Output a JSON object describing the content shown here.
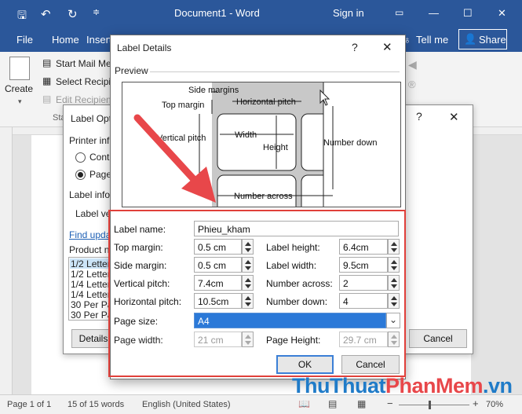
{
  "word": {
    "doc_title": "Document1  -  Word",
    "sign_in": "Sign in",
    "tabs": [
      "File",
      "Home",
      "Insert"
    ],
    "tell_me": "Tell me",
    "share": "Share",
    "ribbon": {
      "create": "Create",
      "start_mail_merge": "Start Mail Me",
      "select_recipients": "Select Recipie",
      "edit_recipients": "Edit Recipien",
      "group_prefix": "Sta"
    }
  },
  "status": {
    "page": "Page 1 of 1",
    "words": "15 of 15 words",
    "language": "English (United States)",
    "zoom": "70%"
  },
  "label_options": {
    "title": "Label Opt",
    "printer_info": "Printer inf",
    "cont": "Cont",
    "page": "Page",
    "label_info": "Label info",
    "label_vendor": "Label ve",
    "find_updates": "Find upda",
    "product_number": "Product n",
    "products": [
      "1/2 Letter",
      "1/2 Letter",
      "1/4 Letter",
      "1/4 Letter",
      "30 Per Pa",
      "30 Per Pa"
    ],
    "details_btn": "Details",
    "cancel_btn": "Cancel"
  },
  "dialog": {
    "title": "Label Details",
    "help": "?",
    "close": "✕",
    "preview_label": "Preview",
    "preview": {
      "side_margins": "Side margins",
      "top_margin": "Top margin",
      "horizontal_pitch": "Horizontal pitch",
      "width": "Width",
      "height": "Height",
      "vertical_pitch": "Vertical pitch",
      "number_down": "Number down",
      "number_across": "Number across"
    },
    "fields": {
      "label_name": {
        "label": "Label name:",
        "value": "Phieu_kham"
      },
      "top_margin": {
        "label": "Top margin:",
        "value": "0.5 cm"
      },
      "label_height": {
        "label": "Label height:",
        "value": "6.4cm"
      },
      "side_margin": {
        "label": "Side margin:",
        "value": "0.5 cm"
      },
      "label_width": {
        "label": "Label width:",
        "value": "9.5cm"
      },
      "vertical_pitch": {
        "label": "Vertical pitch:",
        "value": "7.4cm"
      },
      "number_across": {
        "label": "Number across:",
        "value": "2"
      },
      "horizontal_pitch": {
        "label": "Horizontal pitch:",
        "value": "10.5cm"
      },
      "number_down": {
        "label": "Number down:",
        "value": "4"
      },
      "page_size": {
        "label": "Page size:",
        "value": "A4"
      },
      "page_width": {
        "label": "Page width:",
        "value": "21 cm"
      },
      "page_height": {
        "label": "Page Height:",
        "value": "29.7 cm"
      }
    },
    "ok": "OK",
    "cancel": "Cancel"
  },
  "watermark": {
    "part1": "ThuThuat",
    "part2": "PhanMem",
    "part3": ".vn"
  },
  "colors": {
    "word_blue": "#2b579a",
    "highlight_red": "#e0403a",
    "arrow_red": "#e8474a"
  }
}
